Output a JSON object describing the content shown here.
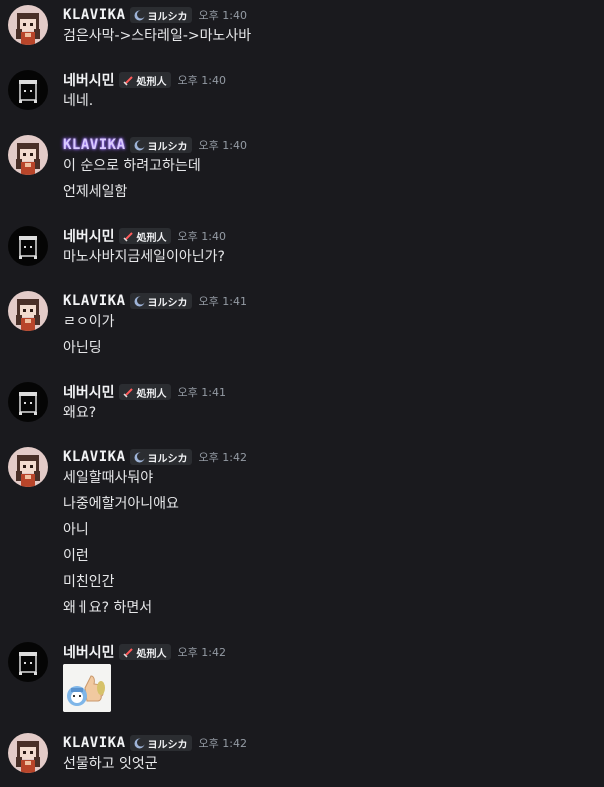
{
  "users": {
    "klavika": {
      "name": "KLAVIKA",
      "tag": "ヨルシカ"
    },
    "nebeo": {
      "name": "네버시민",
      "tag": "処刑人"
    }
  },
  "messages": [
    {
      "time": "오후 1:40",
      "lines": [
        "검은사막->스타레일->마노사바"
      ]
    },
    {
      "time": "오후 1:40",
      "lines": [
        "네네."
      ]
    },
    {
      "time": "오후 1:40",
      "lines": [
        "이 순으로 하려고하는데",
        "언제세일함"
      ]
    },
    {
      "time": "오후 1:40",
      "lines": [
        "마노사바지금세일이아닌가?"
      ]
    },
    {
      "time": "오후 1:41",
      "lines": [
        "ㄹㅇ이가",
        "아닌딩"
      ]
    },
    {
      "time": "오후 1:41",
      "lines": [
        "왜요?"
      ]
    },
    {
      "time": "오후 1:42",
      "lines": [
        "세일할때사둬야",
        "나중에할거아니애요",
        "아니",
        "이런",
        "미친인간",
        "왜ㅔ요? 하면서"
      ]
    },
    {
      "time": "오후 1:42",
      "lines": []
    },
    {
      "time": "오후 1:42",
      "lines": [
        "선물하고 잇엇군"
      ]
    }
  ],
  "colors": {
    "background": "#1a1a1e",
    "text": "#dbdee1",
    "timestamp": "#949ba4",
    "tag_bg": "#2b2d31"
  }
}
